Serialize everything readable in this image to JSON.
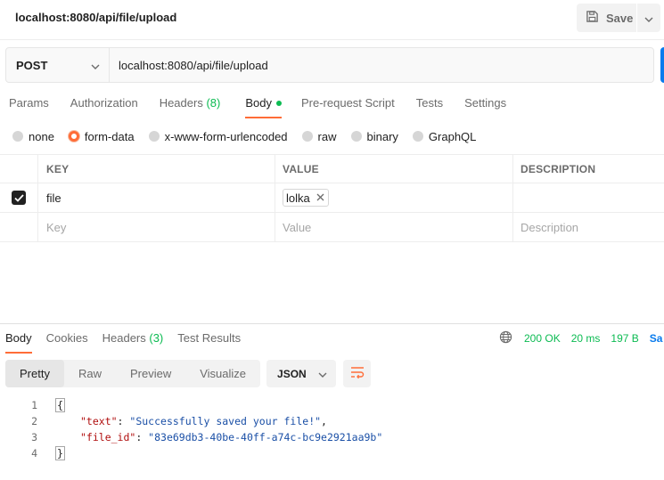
{
  "title": "localhost:8080/api/file/upload",
  "save_label": "Save",
  "request": {
    "method": "POST",
    "url": "localhost:8080/api/file/upload"
  },
  "request_tabs": [
    {
      "label": "Params"
    },
    {
      "label": "Authorization"
    },
    {
      "label": "Headers",
      "count": "(8)"
    },
    {
      "label": "Body"
    },
    {
      "label": "Pre-request Script"
    },
    {
      "label": "Tests"
    },
    {
      "label": "Settings"
    }
  ],
  "body_types": [
    "none",
    "form-data",
    "x-www-form-urlencoded",
    "raw",
    "binary",
    "GraphQL"
  ],
  "body_type_selected": "form-data",
  "kv_table": {
    "headers": [
      "KEY",
      "VALUE",
      "DESCRIPTION"
    ],
    "rows": [
      {
        "key": "file",
        "value": "lolka",
        "description": ""
      }
    ],
    "placeholders": {
      "key": "Key",
      "value": "Value",
      "description": "Description"
    }
  },
  "response_tabs": [
    {
      "label": "Body"
    },
    {
      "label": "Cookies"
    },
    {
      "label": "Headers",
      "count": "(3)"
    },
    {
      "label": "Test Results"
    }
  ],
  "response_meta": {
    "status": "200 OK",
    "time": "20 ms",
    "size": "197 B",
    "save_cut": "Sa"
  },
  "view_modes": [
    "Pretty",
    "Raw",
    "Preview",
    "Visualize"
  ],
  "view_mode_selected": "Pretty",
  "format": "JSON",
  "response_body": {
    "line_numbers": [
      "1",
      "2",
      "3",
      "4"
    ],
    "open_brace": "{",
    "close_brace": "}",
    "fields": [
      {
        "key": "\"text\"",
        "value": "\"Successfully saved your file!\"",
        "trailing": ","
      },
      {
        "key": "\"file_id\"",
        "value": "\"83e69db3-40be-40ff-a74c-bc9e2921aa9b\"",
        "trailing": ""
      }
    ]
  },
  "colors": {
    "accent": "#ff6c37",
    "success": "#0cbb52",
    "link": "#097bed",
    "json_key": "#b00e0e",
    "json_value": "#1a4fa6"
  },
  "icons": {
    "save": "floppy-disk-icon",
    "caret": "chevron-down-icon",
    "globe": "globe-icon",
    "wrap": "wrap-lines-icon",
    "check": "check-icon",
    "remove": "close-icon"
  }
}
